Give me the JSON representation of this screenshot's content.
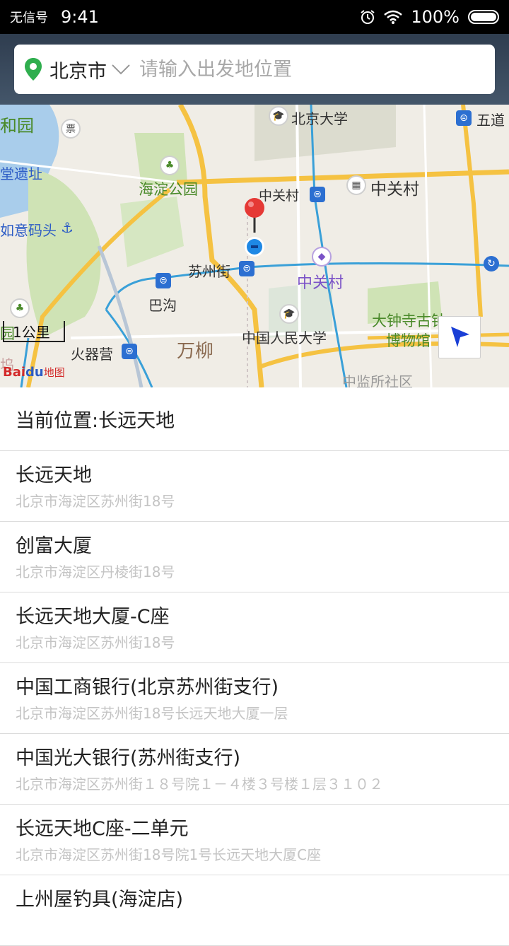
{
  "status_bar": {
    "carrier": "无信号",
    "time": "9:41",
    "battery": "100%"
  },
  "search": {
    "city": "北京市",
    "placeholder": "请输入出发地位置"
  },
  "map": {
    "labels": {
      "hepingyuan": "和园",
      "tangyizhi": "堂遗址",
      "ruyimatou": "如意码头",
      "peking_univ": "北京大学",
      "wudao": "五道",
      "haidian_park": "海淀公园",
      "zhongguancun_station": "中关村",
      "zhongguancun_poi": "中关村",
      "suzhoujie": "苏州街",
      "zhongguancun_mall": "中关村",
      "bagou": "巴沟",
      "renmin_univ": "中国人民大学",
      "dazhongsi_1": "大钟寺古钟",
      "dazhongsi_2": "博物馆",
      "huoqiying": "火器营",
      "wanliu": "万柳",
      "zhongjiansuo": "中监所社区",
      "yuan_partial": "园",
      "nan_partial": "坞"
    },
    "scale": "1公里",
    "logo": {
      "bai": "Bai",
      "du": "du",
      "ditu": "地图"
    }
  },
  "current_location": "当前位置:长远天地",
  "results": [
    {
      "name": "长远天地",
      "address": "北京市海淀区苏州街18号"
    },
    {
      "name": "创富大厦",
      "address": "北京市海淀区丹棱街18号"
    },
    {
      "name": "长远天地大厦-C座",
      "address": "北京市海淀区苏州街18号"
    },
    {
      "name": "中国工商银行(北京苏州街支行)",
      "address": "北京市海淀区苏州街18号长远天地大厦一层"
    },
    {
      "name": "中国光大银行(苏州街支行)",
      "address": "北京市海淀区苏州街１８号院１－４楼３号楼１层３１０２"
    },
    {
      "name": "长远天地C座-二单元",
      "address": "北京市海淀区苏州街18号院1号长远天地大厦C座"
    },
    {
      "name": "上州屋钓具(海淀店)",
      "address": ""
    }
  ],
  "colors": {
    "pin_green": "#2fae4e",
    "locate_blue": "#1a3fd6",
    "road_yellow": "#f5c242",
    "subway_blue": "#3aa0d8"
  }
}
